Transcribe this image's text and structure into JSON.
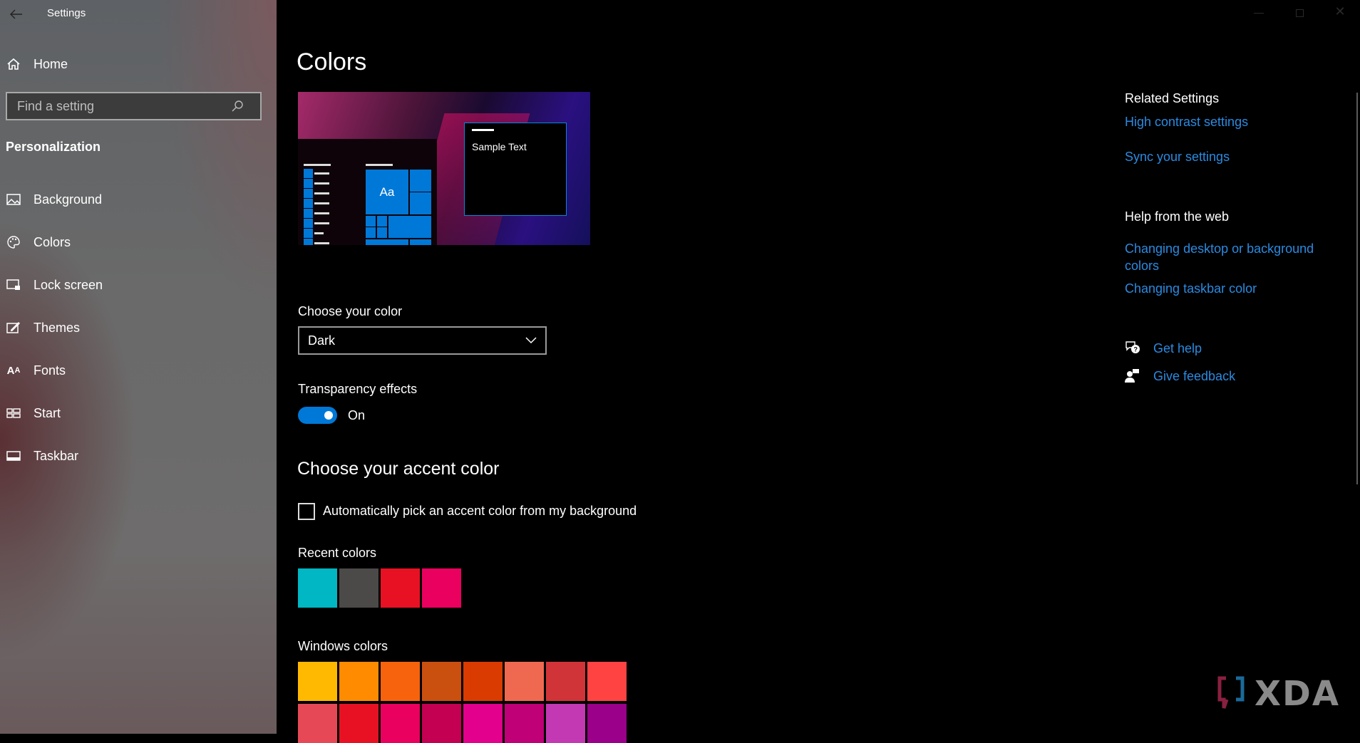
{
  "window": {
    "title": "Settings"
  },
  "sidebar": {
    "home": "Home",
    "search_placeholder": "Find a setting",
    "section": "Personalization",
    "items": [
      {
        "label": "Background",
        "icon": "image-icon"
      },
      {
        "label": "Colors",
        "icon": "palette-icon"
      },
      {
        "label": "Lock screen",
        "icon": "lock-screen-icon"
      },
      {
        "label": "Themes",
        "icon": "themes-icon"
      },
      {
        "label": "Fonts",
        "icon": "fonts-icon"
      },
      {
        "label": "Start",
        "icon": "start-icon"
      },
      {
        "label": "Taskbar",
        "icon": "taskbar-icon"
      }
    ],
    "selected": "Colors"
  },
  "main": {
    "title": "Colors",
    "preview": {
      "sample_text": "Sample Text",
      "tile_text": "Aa",
      "accent": "#0078d7"
    },
    "choose_color_label": "Choose your color",
    "choose_color_value": "Dark",
    "transparency_label": "Transparency effects",
    "transparency_state": "On",
    "transparency_on": true,
    "accent_heading": "Choose your accent color",
    "auto_pick_label": "Automatically pick an accent color from my background",
    "auto_pick_checked": false,
    "recent_label": "Recent colors",
    "recent_colors": [
      "#00b7c3",
      "#4c4a48",
      "#e81123",
      "#ea005e"
    ],
    "windows_label": "Windows colors",
    "windows_colors": [
      [
        "#ffb900",
        "#ff8c00",
        "#f7630c",
        "#ca5010",
        "#da3b01",
        "#ef6950",
        "#d13438",
        "#ff4343"
      ],
      [
        "#e74856",
        "#e81123",
        "#ea005e",
        "#c30052",
        "#e3008c",
        "#bf0077",
        "#c239b3",
        "#9a0089"
      ]
    ]
  },
  "right": {
    "related_heading": "Related Settings",
    "related_links": [
      "High contrast settings",
      "Sync your settings"
    ],
    "help_heading": "Help from the web",
    "help_link1_line1": "Changing desktop or background",
    "help_link1_line2": "colors",
    "help_link2": "Changing taskbar color",
    "get_help": "Get help",
    "give_feedback": "Give feedback"
  },
  "watermark": "XDA",
  "colors": {
    "link": "#2b8ae0",
    "accent": "#0078d7"
  }
}
